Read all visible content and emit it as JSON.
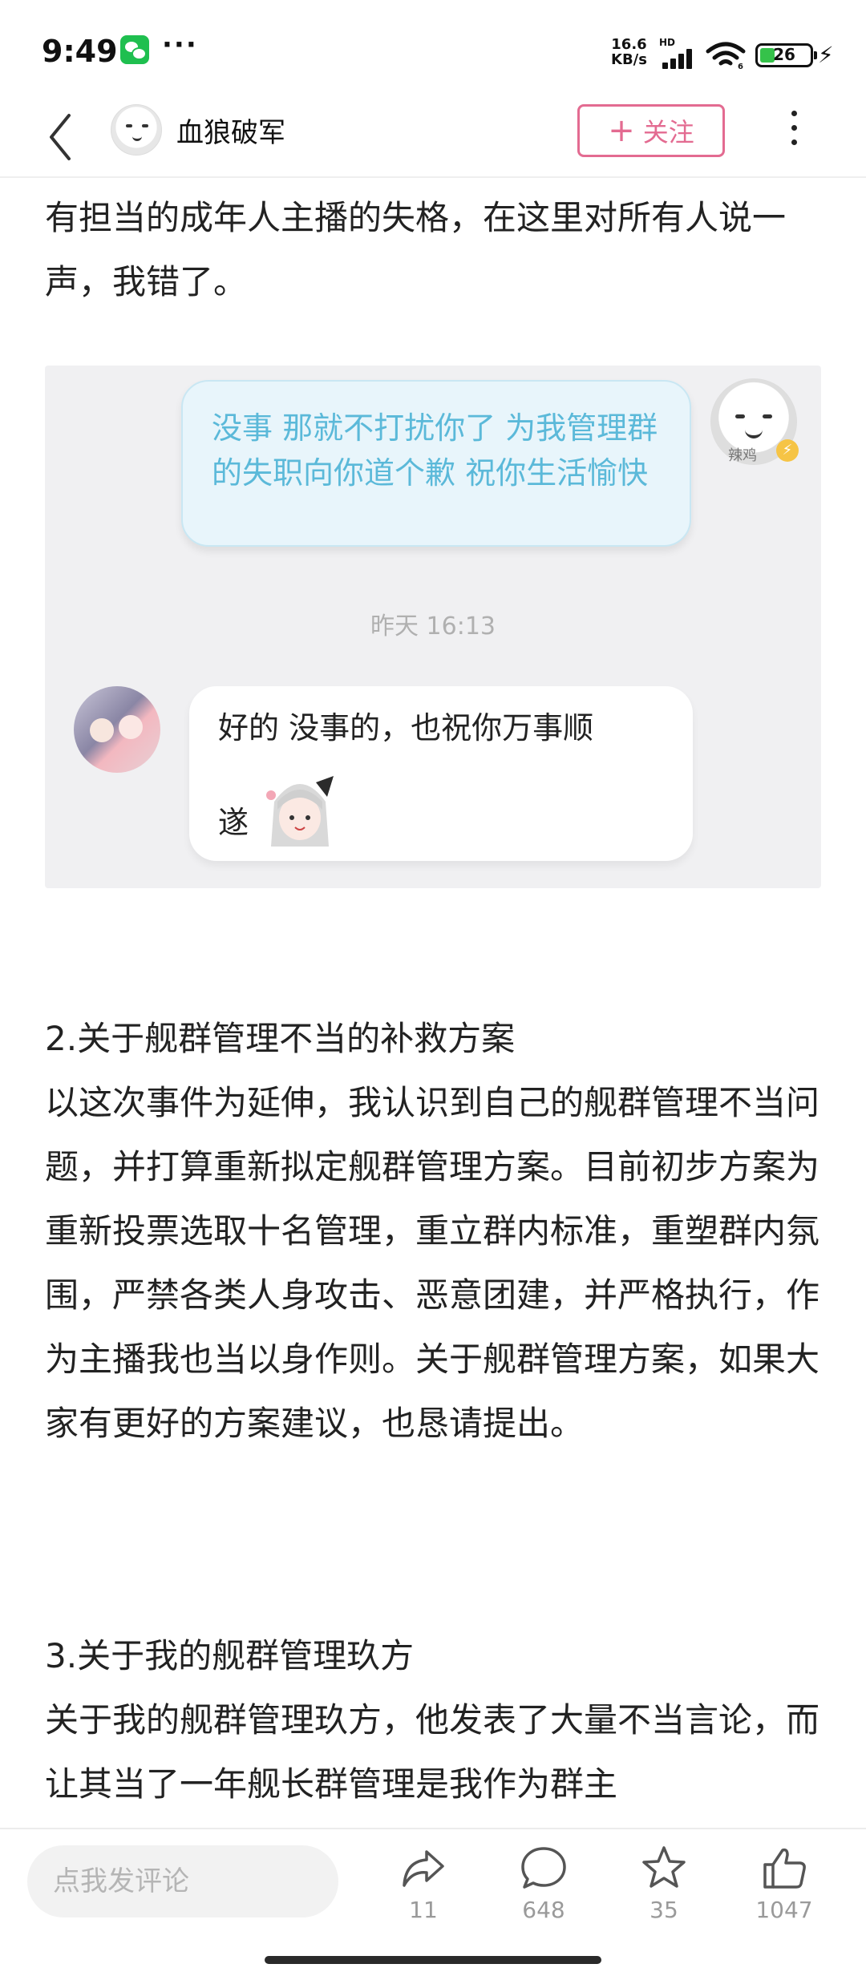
{
  "status_bar": {
    "time": "9:49",
    "more": "···",
    "net_speed_value": "16.6",
    "net_speed_unit": "KB/s",
    "network_type": "HD",
    "battery": "26",
    "colors": {
      "wechat": "#1fbf4f",
      "battery_fill": "#35c24a"
    }
  },
  "header": {
    "author_name": "血狼破军",
    "follow_label": "关注",
    "follow_icon": "plus-icon",
    "accent": "#e36b91"
  },
  "article": {
    "p1": "有担当的成年人主播的失格，在这里对所有人说一声，我错了。",
    "section2_title": "2.关于舰群管理不当的补救方案",
    "section2_body": "以这次事件为延伸，我认识到自己的舰群管理不当问题，并打算重新拟定舰群管理方案。目前初步方案为重新投票选取十名管理，重立群内标准，重塑群内氛围，严禁各类人身攻击、恶意团建，并严格执行，作为主播我也当以身作则。关于舰群管理方案，如果大家有更好的方案建议，也恳请提出。",
    "section3_title": "3.关于我的舰群管理玖方",
    "section3_body": "关于我的舰群管理玖方，他发表了大量不当言论，而让其当了一年舰长群管理是我作为群主"
  },
  "chat_screenshot": {
    "outgoing_message": "没事 那就不打扰你了 为我管理群的失职向你道个歉 祝你生活愉快",
    "avatar_label": "辣鸡",
    "timestamp": "昨天 16:13",
    "incoming_message_line1": "好的 没事的，也祝你万事顺",
    "incoming_message_line2": "遂",
    "outgoing_color": "#5bb9d9"
  },
  "bottom_bar": {
    "comment_placeholder": "点我发评论",
    "share_count": "11",
    "comment_count": "648",
    "favorite_count": "35",
    "like_count": "1047"
  }
}
